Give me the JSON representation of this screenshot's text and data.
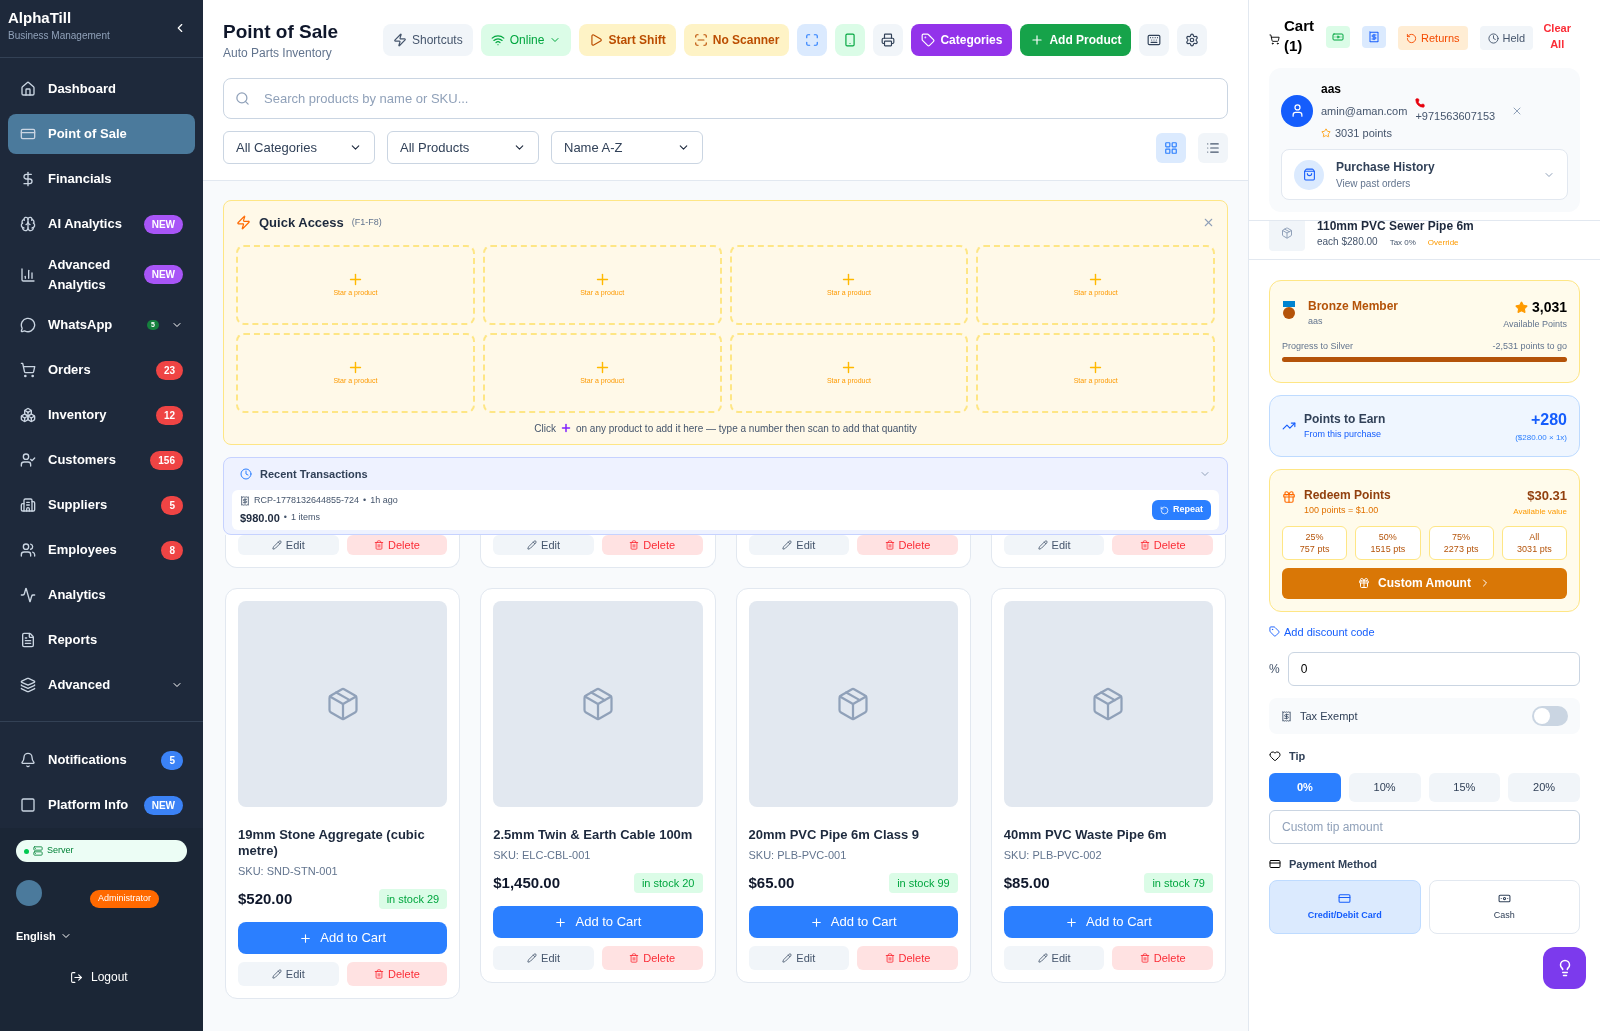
{
  "sidebar": {
    "brand": "AlphaTill",
    "subtitle": "Business Management",
    "items": [
      {
        "label": "Dashboard",
        "selected": false
      },
      {
        "label": "Point of Sale",
        "selected": true
      },
      {
        "label": "Financials",
        "selected": false
      },
      {
        "label": "AI Analytics",
        "selected": false,
        "badge": "NEW",
        "color": "#a855f7"
      },
      {
        "label": "Advanced Analytics",
        "selected": false,
        "badge": "NEW",
        "color": "#a855f7"
      },
      {
        "label": "WhatsApp",
        "selected": false,
        "badge": "5",
        "color": "#15803d",
        "expandable": true
      },
      {
        "label": "Orders",
        "selected": false,
        "badge": "23",
        "color": "#ef4444"
      },
      {
        "label": "Inventory",
        "selected": false,
        "badge": "12",
        "color": "#ef4444"
      },
      {
        "label": "Customers",
        "selected": false,
        "badge": "156",
        "color": "#ef4444"
      },
      {
        "label": "Suppliers",
        "selected": false,
        "badge": "5",
        "color": "#ef4444"
      },
      {
        "label": "Employees",
        "selected": false,
        "badge": "8",
        "color": "#ef4444"
      },
      {
        "label": "Analytics",
        "selected": false
      },
      {
        "label": "Reports",
        "selected": false
      },
      {
        "label": "Advanced",
        "selected": false,
        "expandable": true
      }
    ],
    "bottom_items": [
      {
        "label": "Notifications",
        "badge": "5",
        "color": "#3b82f6"
      },
      {
        "label": "Platform Info",
        "badge": "NEW",
        "color": "#3b82f6"
      }
    ],
    "server": "Server",
    "role": "Administrator",
    "language": "English",
    "logout": "Logout"
  },
  "header": {
    "title": "Point of Sale",
    "subtitle": "Auto Parts Inventory",
    "tools": [
      {
        "kind": "shortcuts",
        "label": "Shortcuts"
      },
      {
        "kind": "online",
        "label": "Online"
      },
      {
        "kind": "start_shift",
        "label": "Start Shift"
      },
      {
        "kind": "no_scanner",
        "label": "No Scanner"
      },
      {
        "kind": "fullscreen"
      },
      {
        "kind": "mobile"
      },
      {
        "kind": "print"
      },
      {
        "kind": "categories",
        "label": "Categories"
      },
      {
        "kind": "add_product",
        "label": "Add Product"
      },
      {
        "kind": "keyboard"
      },
      {
        "kind": "settings"
      }
    ],
    "search": {
      "placeholder": "Search products by name or SKU..."
    },
    "filters": [
      "All Categories",
      "All Products",
      "Name A-Z"
    ],
    "views": [
      {
        "kind": "grid",
        "selected": true
      },
      {
        "kind": "list",
        "selected": false
      }
    ]
  },
  "quick_access": {
    "title": "Quick Access",
    "hint": "(F1-F8)",
    "slots": [
      "Star a product",
      "Star a product",
      "Star a product",
      "Star a product",
      "Star a product",
      "Star a product",
      "Star a product",
      "Star a product"
    ],
    "note_before": "Click",
    "note_after": "on any product to add it here — type a number then scan to add that quantity"
  },
  "recent_transactions": {
    "title": "Recent Transactions",
    "items": [
      {
        "receipt": "RCP-1778132644855-724",
        "time": "1h ago",
        "separator": "•",
        "total": "$980.00",
        "count": "1 items",
        "action": "Repeat"
      }
    ]
  },
  "partial_cards": [
    {
      "edit": "Edit",
      "delete": "Delete"
    },
    {
      "edit": "Edit",
      "delete": "Delete"
    },
    {
      "edit": "Edit",
      "delete": "Delete"
    },
    {
      "edit": "Edit",
      "delete": "Delete"
    }
  ],
  "products": [
    {
      "name": "19mm Stone Aggregate (cubic metre)",
      "sku": "SKU: SND-STN-001",
      "price": "$520.00",
      "stock": "in stock 29",
      "add": "Add to Cart",
      "edit": "Edit",
      "delete": "Delete"
    },
    {
      "name": "2.5mm Twin & Earth Cable 100m",
      "sku": "SKU: ELC-CBL-001",
      "price": "$1,450.00",
      "stock": "in stock 20",
      "add": "Add to Cart",
      "edit": "Edit",
      "delete": "Delete"
    },
    {
      "name": "20mm PVC Pipe 6m Class 9",
      "sku": "SKU: PLB-PVC-001",
      "price": "$65.00",
      "stock": "in stock 99",
      "add": "Add to Cart",
      "edit": "Edit",
      "delete": "Delete"
    },
    {
      "name": "40mm PVC Waste Pipe 6m",
      "sku": "SKU: PLB-PVC-002",
      "price": "$85.00",
      "stock": "in stock 79",
      "add": "Add to Cart",
      "edit": "Edit",
      "delete": "Delete"
    }
  ],
  "cart": {
    "title": "Cart",
    "count": "(1)",
    "returns": "Returns",
    "held": "Held",
    "clear": "Clear All",
    "customer": {
      "name": "aas",
      "email": "amin@aman.com",
      "phone": "+971563607153",
      "points": "3031 points",
      "history_title": "Purchase History",
      "history_subtitle": "View past orders"
    },
    "items": [
      {
        "name": "110mm PVC Sewer Pipe 6m",
        "each": "each $280.00",
        "tax": "Tax 0%",
        "override": "Override"
      }
    ],
    "loyalty": {
      "tier": "Bronze Member",
      "name": "aas",
      "points": "3,031",
      "points_label": "Available Points",
      "progress_label": "Progress to Silver",
      "to_go": "-2,531 points to go",
      "level": 1
    },
    "earn": {
      "title": "Points to Earn",
      "subtitle": "From this purchase",
      "value": "+280",
      "detail": "($280.00 × 1x)"
    },
    "redeem": {
      "title": "Redeem Points",
      "rate": "100 points = $1.00",
      "value": "$30.31",
      "value_label": "Available value",
      "options": [
        {
          "pct": "25%",
          "pts": "757 pts"
        },
        {
          "pct": "50%",
          "pts": "1515 pts"
        },
        {
          "pct": "75%",
          "pts": "2273 pts"
        },
        {
          "pct": "All",
          "pts": "3031 pts"
        }
      ],
      "custom": "Custom Amount"
    },
    "discount": {
      "link": "Add discount code",
      "unit": "%",
      "value": "0"
    },
    "tax_exempt": {
      "label": "Tax Exempt",
      "on": false
    },
    "tip": {
      "label": "Tip",
      "options": [
        {
          "label": "0%",
          "selected": true
        },
        {
          "label": "10%",
          "selected": false
        },
        {
          "label": "15%",
          "selected": false
        },
        {
          "label": "20%",
          "selected": false
        }
      ],
      "placeholder": "Custom tip amount"
    },
    "payment": {
      "label": "Payment Method",
      "methods": [
        {
          "kind": "card",
          "label": "Credit/Debit Card",
          "selected": true
        },
        {
          "kind": "cash",
          "label": "Cash",
          "selected": false
        }
      ]
    }
  }
}
